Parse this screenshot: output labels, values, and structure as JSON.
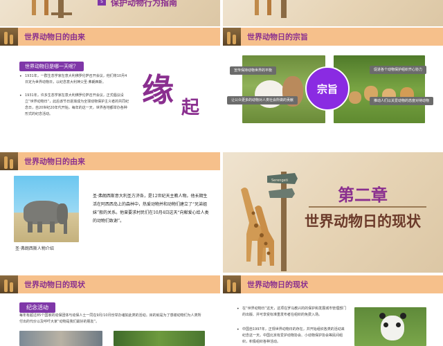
{
  "slide1": {
    "num": "5",
    "title": "保护动物行为指南"
  },
  "slide3": {
    "title": "世界动物日的由来",
    "badge": "世界动物日是哪一天呢？",
    "para1": "1931年，一群生态学家在意大利佛罗伦萨召开会议，他们将10月4日定为世界动物日，以纪念意大利神父圣·弗朗西斯。",
    "para2": "1931年，许多生态学家在意大利佛罗伦萨召开会议，正式倡议设立“世界动物日”，此后该节日逐渐成为全球动物保护主义者的共同纪念日，自20世纪20年代开始，每年的这一天，世界各地都举办各种形式的纪念活动。",
    "char1": "缘",
    "char2": "起"
  },
  "slide4": {
    "title": "世界动物日的宗旨",
    "pills": [
      "宣传保持动物世界的平衡",
      "促进各个动物保护组织齐心协力",
      "让公众更多的动物对人类社会所做的贡献",
      "推动人们以关爱动物的态度对待动物"
    ],
    "circle": "宗旨"
  },
  "slide5": {
    "title": "世界动物日的由来",
    "caption": "圣·弗朗西斯人物介绍",
    "para": "圣·弗朗西斯意大利圣方济各，是12世纪天主教人物。他长期生活在阿西西岛上的森林中，热爱动物并和动物们建立了“兄弟姐妹”般的关系。他曾要求村民们在10月4日这天“向献爱心给人类的动物们致谢”。"
  },
  "slide6": {
    "chapter": "第二章",
    "subtitle": "世界动物日的现状",
    "sign": "Serengeti"
  },
  "slide7": {
    "title": "世界动物日的现状",
    "badge": "纪念活动",
    "para": "每年有超过85个国家的动保团体与动保人士一同在9月/10月份举办诸如此类的活动。目的就是为了感谢动物们为人类所付出的代价以及呼吁大家“动物是我们最好的朋友”。"
  },
  "slide8": {
    "title": "世界动物日的现状",
    "b1": "在“世界动物日”这天，这项在罗马教兴的的保护和发展城市管理部门的出版、并可享受标准重发布者在组织的免费入场。",
    "b2": "中国自1997年，正规世界动物日的存在，并开始组织各类的活动来纪念这一天。中国北京有爱护动物协会、小动物保护协会等民间组织，积极组织各种活动。"
  }
}
